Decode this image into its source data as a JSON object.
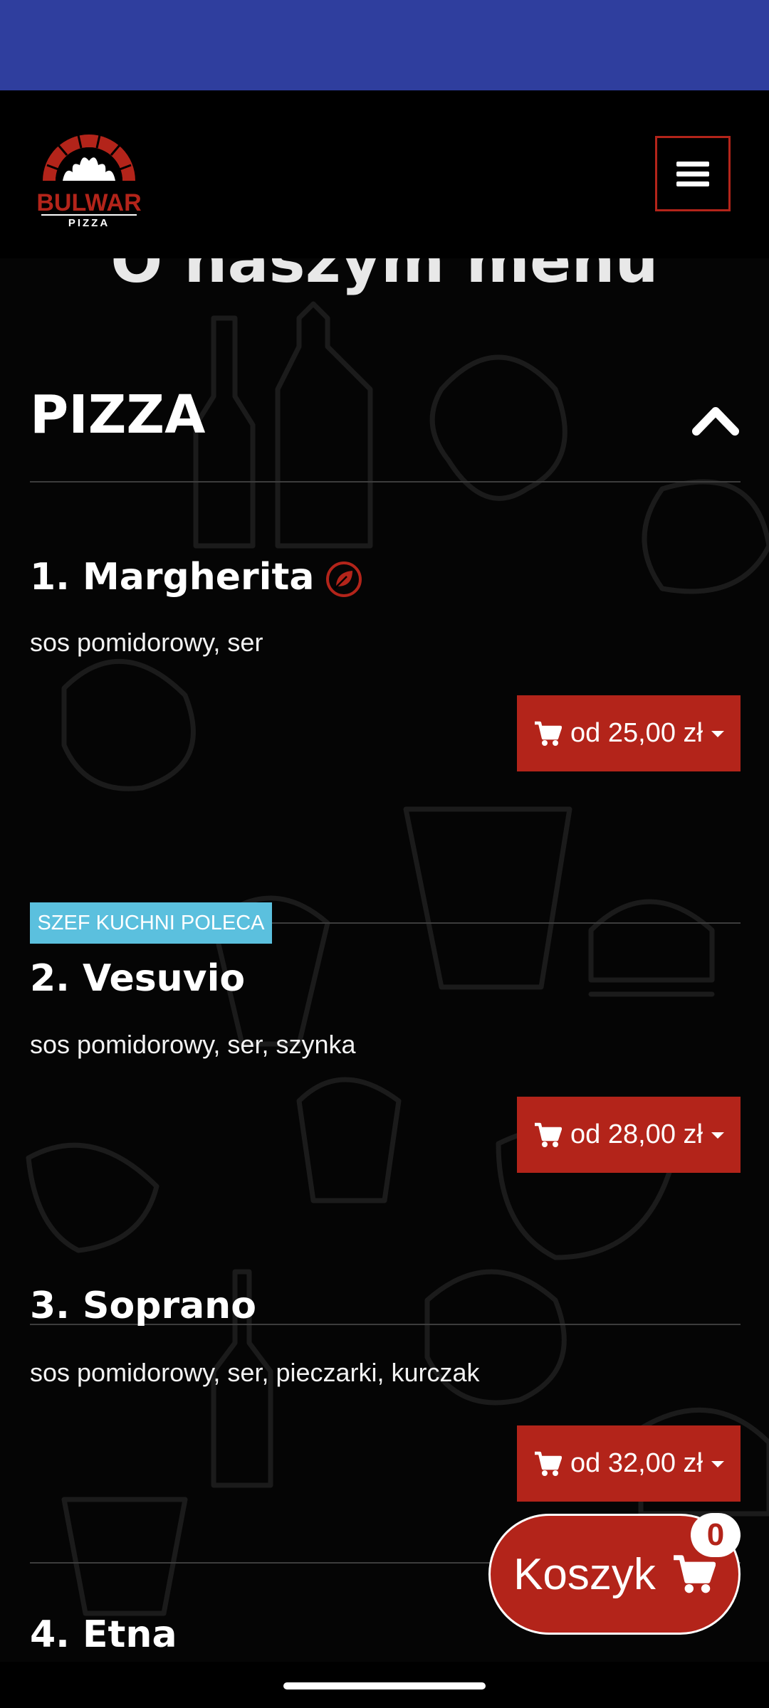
{
  "brand": {
    "name": "BULWAR",
    "sub": "PIZZA"
  },
  "page": {
    "partial_title": "O naszym menu"
  },
  "section": {
    "title": "PIZZA"
  },
  "items": [
    {
      "name": "1. Margherita",
      "desc": "sos pomidorowy, ser",
      "price": "od 25,00 zł",
      "badge": "",
      "vegetarian": true
    },
    {
      "name": "2. Vesuvio",
      "desc": "sos pomidorowy, ser, szynka",
      "price": "od 28,00 zł",
      "badge": "SZEF KUCHNI POLECA",
      "vegetarian": false
    },
    {
      "name": "3. Soprano",
      "desc": "sos pomidorowy, ser, pieczarki, kurczak",
      "price": "od 32,00 zł",
      "badge": "",
      "vegetarian": false
    },
    {
      "name": "4. Etna",
      "desc": "",
      "price": "",
      "badge": "",
      "vegetarian": false
    }
  ],
  "cart": {
    "label": "Koszyk",
    "count": "0"
  },
  "icons": {
    "menu": "hamburger-icon",
    "collapse": "chevron-up-icon",
    "vegetarian": "leaf-icon",
    "cart": "shopping-cart-icon",
    "dropdown": "caret-down-icon"
  },
  "colors": {
    "status_bar": "#2f3e9e",
    "accent_red": "#b3241a",
    "badge_blue": "#5bc0de",
    "background": "#000000"
  }
}
